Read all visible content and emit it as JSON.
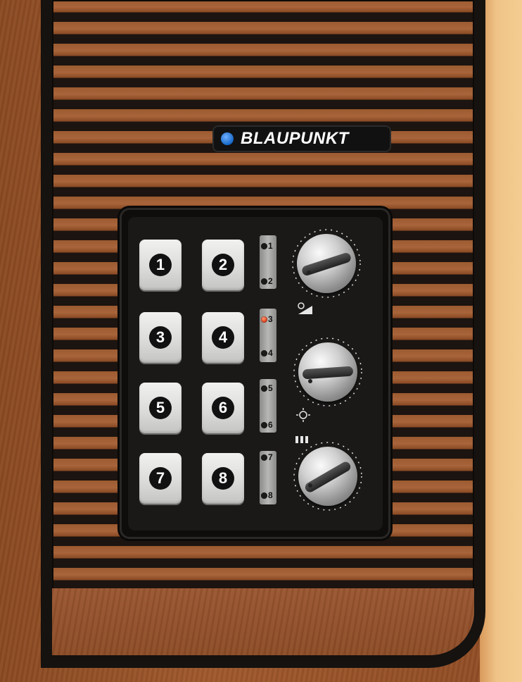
{
  "brand": {
    "name": "BLAUPUNKT",
    "dot_color": "#1f78d1"
  },
  "channel_buttons": [
    {
      "label": "1"
    },
    {
      "label": "2"
    },
    {
      "label": "3"
    },
    {
      "label": "4"
    },
    {
      "label": "5"
    },
    {
      "label": "6"
    },
    {
      "label": "7"
    },
    {
      "label": "8"
    }
  ],
  "indicators": [
    {
      "label": "1",
      "active": false
    },
    {
      "label": "2",
      "active": false
    },
    {
      "label": "3",
      "active": true
    },
    {
      "label": "4",
      "active": false
    },
    {
      "label": "5",
      "active": false
    },
    {
      "label": "6",
      "active": false
    },
    {
      "label": "7",
      "active": false
    },
    {
      "label": "8",
      "active": false
    }
  ],
  "knobs": [
    {
      "name": "volume-knob",
      "symbol": "power-volume-icon"
    },
    {
      "name": "brightness-knob",
      "symbol": "sun-icon"
    },
    {
      "name": "color-knob",
      "symbol": "color-bars-icon"
    }
  ],
  "colors": {
    "wood": "#9c5a30",
    "slat": "#1c1410",
    "indicator_active": "#d03010"
  }
}
